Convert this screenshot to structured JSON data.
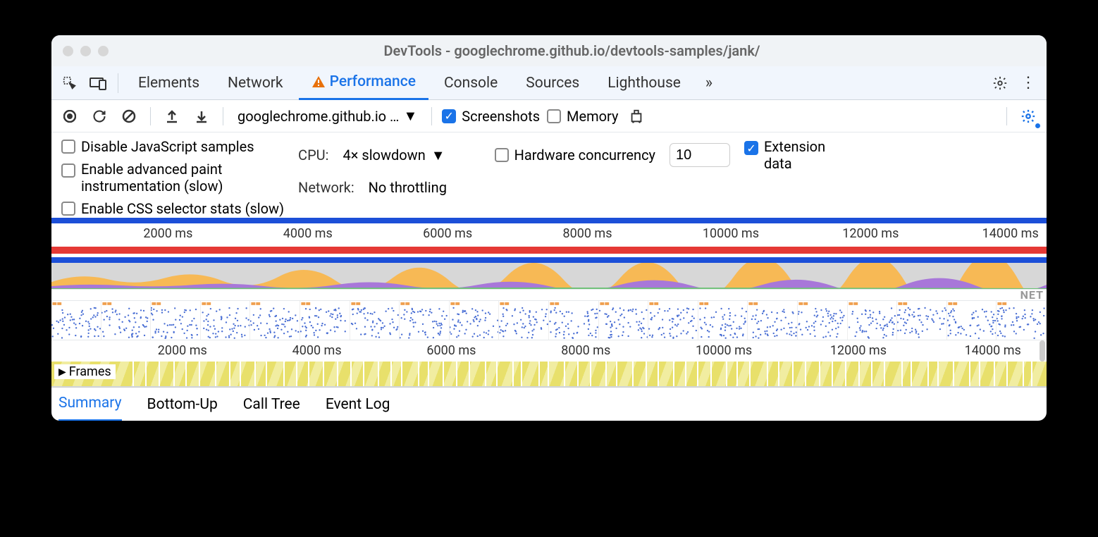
{
  "window": {
    "title": "DevTools - googlechrome.github.io/devtools-samples/jank/"
  },
  "tabs": [
    "Elements",
    "Network",
    "Performance",
    "Console",
    "Sources",
    "Lighthouse"
  ],
  "active_tab": "Performance",
  "toolbar": {
    "origin": "googlechrome.github.io …",
    "screenshots_label": "Screenshots",
    "memory_label": "Memory"
  },
  "options": {
    "disable_js": "Disable JavaScript samples",
    "advanced_paint_l1": "Enable advanced paint",
    "advanced_paint_l2": "instrumentation (slow)",
    "css_selector": "Enable CSS selector stats (slow)",
    "cpu_label": "CPU:",
    "cpu_value": "4× slowdown",
    "network_label": "Network:",
    "network_value": "No throttling",
    "hw_label": "Hardware concurrency",
    "hw_value": "10",
    "ext_l1": "Extension",
    "ext_l2": "data"
  },
  "timeline": {
    "ticks": [
      "2000 ms",
      "4000 ms",
      "6000 ms",
      "8000 ms",
      "10000 ms",
      "12000 ms",
      "14000 ms"
    ],
    "net_label": "NET",
    "frames_label": "Frames"
  },
  "detail_tabs": [
    "Summary",
    "Bottom-Up",
    "Call Tree",
    "Event Log"
  ]
}
